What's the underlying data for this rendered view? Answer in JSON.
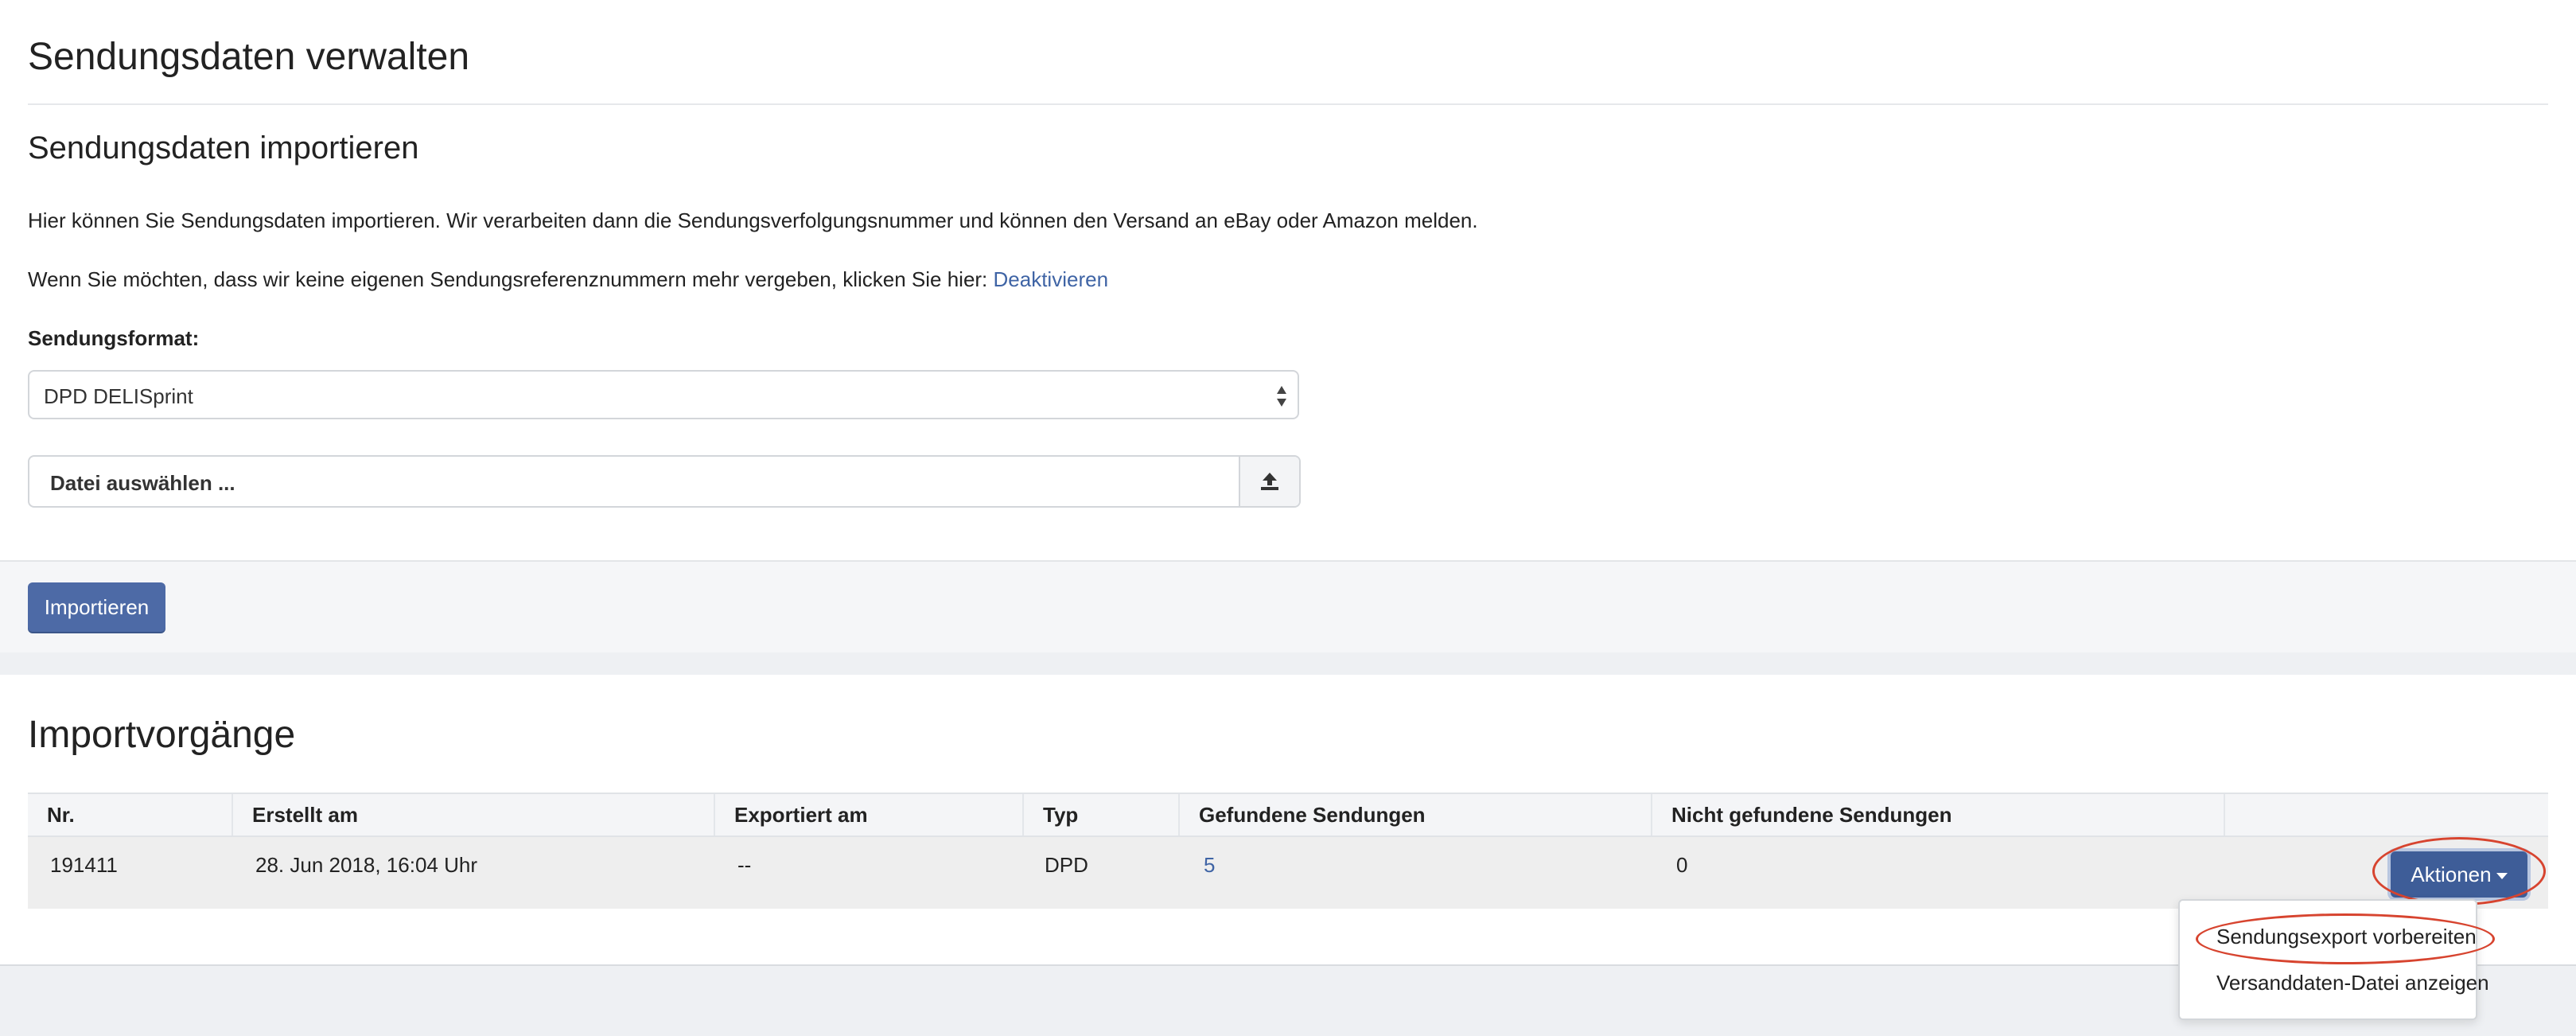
{
  "page": {
    "title": "Sendungsdaten verwalten"
  },
  "import_section": {
    "title": "Sendungsdaten importieren",
    "intro_text": "Hier können Sie Sendungsdaten importieren. Wir verarbeiten dann die Sendungsverfolgungsnummer und können den Versand an eBay oder Amazon melden.",
    "deactivate_text": "Wenn Sie möchten, dass wir keine eigenen Sendungsreferenznummern mehr vergeben, klicken Sie hier: ",
    "deactivate_link": "Deaktivieren",
    "format_label": "Sendungsformat:",
    "format_value": "DPD DELISprint",
    "file_placeholder": "Datei auswählen ...",
    "import_button": "Importieren"
  },
  "imports": {
    "title": "Importvorgänge",
    "columns": [
      "Nr.",
      "Erstellt am",
      "Exportiert am",
      "Typ",
      "Gefundene Sendungen",
      "Nicht gefundene Sendungen"
    ],
    "rows": [
      {
        "nr": "191411",
        "created": "28. Jun 2018, 16:04 Uhr",
        "exported": "--",
        "type": "DPD",
        "found": "5",
        "not_found": "0"
      }
    ],
    "actions_button": "Aktionen",
    "dropdown_items": [
      "Sendungsexport vorbereiten",
      "Versanddaten-Datei anzeigen"
    ]
  },
  "colors": {
    "primary_button": "#4d6aa6",
    "link": "#3f64a5",
    "highlight_ring": "#d7442f"
  }
}
